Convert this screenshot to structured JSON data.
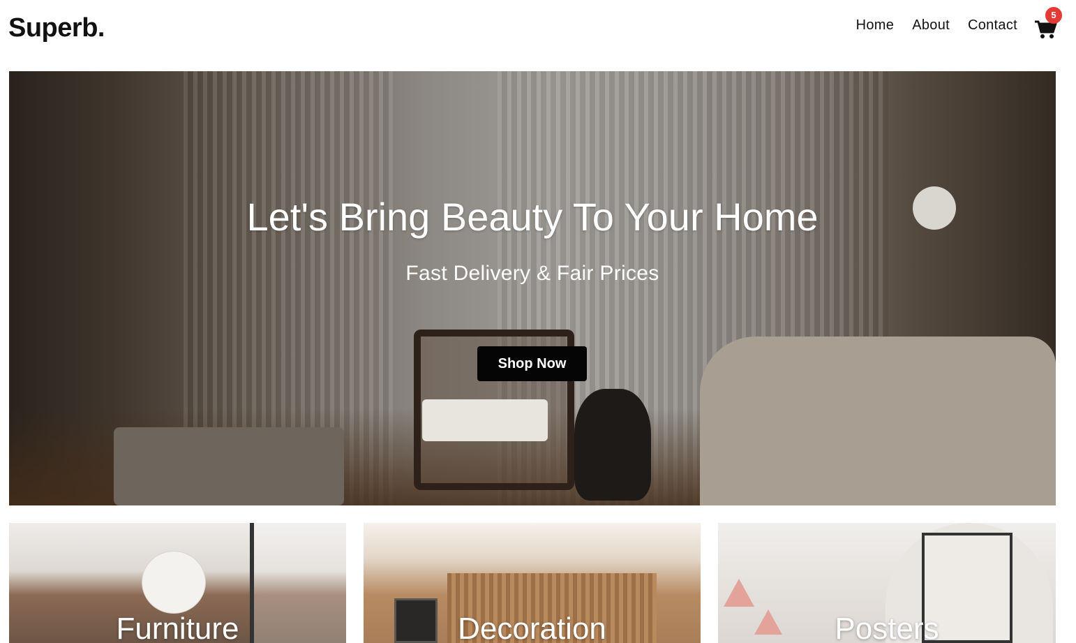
{
  "header": {
    "logo": "Superb.",
    "nav": [
      {
        "label": "Home"
      },
      {
        "label": "About"
      },
      {
        "label": "Contact"
      }
    ],
    "cart_count": "5"
  },
  "hero": {
    "title": "Let's Bring Beauty To Your Home",
    "subtitle": "Fast Delivery & Fair Prices",
    "cta_label": "Shop Now"
  },
  "categories": [
    {
      "label": "Furniture"
    },
    {
      "label": "Decoration"
    },
    {
      "label": "Posters"
    }
  ],
  "colors": {
    "badge": "#e53935",
    "button": "#050505"
  }
}
